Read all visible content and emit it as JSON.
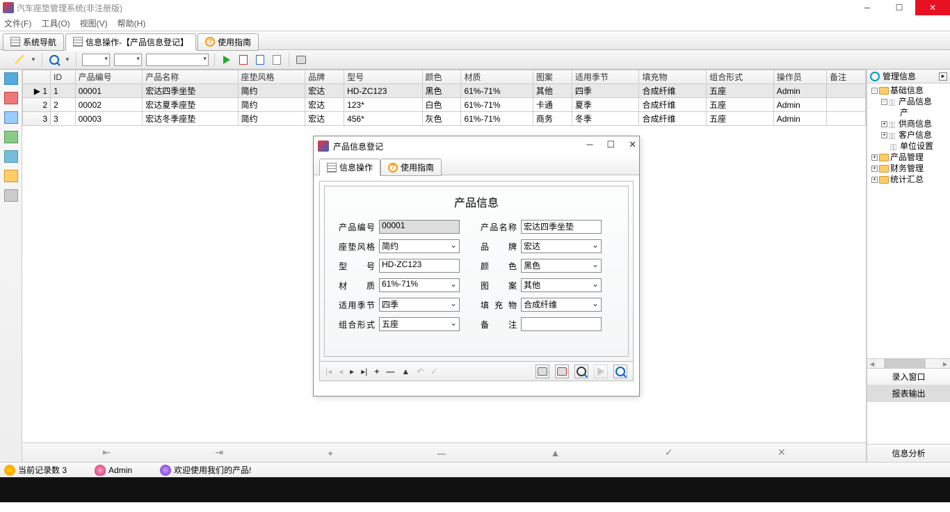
{
  "window": {
    "title": "汽车座垫管理系统(非注册版)"
  },
  "menu": [
    "文件(F)",
    "工具(O)",
    "视图(V)",
    "帮助(H)"
  ],
  "tabs": [
    {
      "label": "系统导航"
    },
    {
      "label": "信息操作-【产品信息登记】"
    },
    {
      "label": "使用指南"
    }
  ],
  "grid": {
    "columns": [
      "ID",
      "产品编号",
      "产品名称",
      "座垫风格",
      "品牌",
      "型号",
      "颜色",
      "材质",
      "图案",
      "适用季节",
      "填充物",
      "组合形式",
      "操作员",
      "备注"
    ],
    "rows": [
      {
        "n": "1",
        "id": "1",
        "code": "00001",
        "name": "宏达四季坐垫",
        "style": "简约",
        "brand": "宏达",
        "model": "HD-ZC123",
        "color": "黑色",
        "mat": "61%-71%",
        "pat": "其他",
        "season": "四季",
        "fill": "合成纤维",
        "combo": "五座",
        "op": "Admin",
        "note": ""
      },
      {
        "n": "2",
        "id": "2",
        "code": "00002",
        "name": "宏达夏季座垫",
        "style": "简约",
        "brand": "宏达",
        "model": "123*",
        "color": "白色",
        "mat": "61%-71%",
        "pat": "卡通",
        "season": "夏季",
        "fill": "合成纤维",
        "combo": "五座",
        "op": "Admin",
        "note": ""
      },
      {
        "n": "3",
        "id": "3",
        "code": "00003",
        "name": "宏达冬季座垫",
        "style": "简约",
        "brand": "宏达",
        "model": "456*",
        "color": "灰色",
        "mat": "61%-71%",
        "pat": "商务",
        "season": "冬季",
        "fill": "合成纤维",
        "combo": "五座",
        "op": "Admin",
        "note": ""
      }
    ]
  },
  "rpanel": {
    "title": "管理信息",
    "tree": [
      {
        "lvl": 0,
        "exp": "-",
        "icon": "fld",
        "label": "基础信息"
      },
      {
        "lvl": 1,
        "exp": "-",
        "icon": "key",
        "label": "产品信息"
      },
      {
        "lvl": 2,
        "exp": "",
        "icon": "",
        "label": "产"
      },
      {
        "lvl": 1,
        "exp": "+",
        "icon": "key",
        "label": "供商信息"
      },
      {
        "lvl": 1,
        "exp": "+",
        "icon": "key",
        "label": "客户信息"
      },
      {
        "lvl": 1,
        "exp": "",
        "icon": "key",
        "label": "单位设置"
      },
      {
        "lvl": 0,
        "exp": "+",
        "icon": "fld",
        "label": "产品管理"
      },
      {
        "lvl": 0,
        "exp": "+",
        "icon": "fld",
        "label": "财务管理"
      },
      {
        "lvl": 0,
        "exp": "+",
        "icon": "fld",
        "label": "统计汇总"
      }
    ],
    "tabs": [
      "录入窗口",
      "报表输出"
    ],
    "foot": "信息分析"
  },
  "status": {
    "records": "当前记录数 3",
    "user": "Admin",
    "welcome": "欢迎使用我们的产品!"
  },
  "modal": {
    "title": "产品信息登记",
    "tabs": [
      "信息操作",
      "使用指南"
    ],
    "heading": "产品信息",
    "fields": {
      "code_lbl": "产品编号",
      "code": "00001",
      "name_lbl": "产品名称",
      "name": "宏达四季坐垫",
      "style_lbl": "座垫风格",
      "style": "简约",
      "brand_lbl": "品　　牌",
      "brand": "宏达",
      "model_lbl": "型　　号",
      "model": "HD-ZC123",
      "color_lbl": "颜　　色",
      "color": "黑色",
      "mat_lbl": "材　　质",
      "mat": "61%-71%",
      "pat_lbl": "图　　案",
      "pat": "其他",
      "season_lbl": "适用季节",
      "season": "四季",
      "fill_lbl": "填 充 物",
      "fill": "合成纤维",
      "combo_lbl": "组合形式",
      "combo": "五座",
      "note_lbl": "备　　注",
      "note": ""
    }
  }
}
